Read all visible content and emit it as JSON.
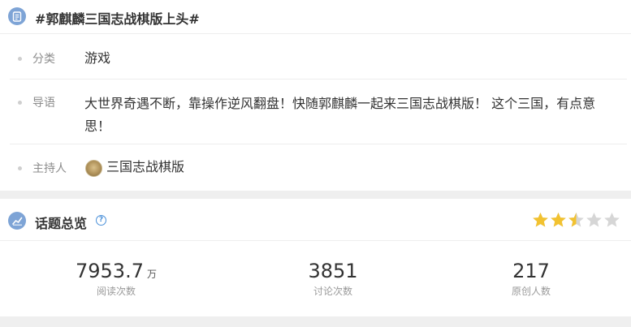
{
  "topic": {
    "title": "#郭麒麟三国志战棋版上头#",
    "icon": "document-icon"
  },
  "details": {
    "category_label": "分类",
    "category_value": "游戏",
    "intro_label": "导语",
    "intro_value": "大世界奇遇不断，靠操作逆风翻盘！快随郭麒麟一起来三国志战棋版！ 这个三国，有点意思！",
    "host_label": "主持人",
    "host_value": "三国志战棋版"
  },
  "overview": {
    "title": "话题总览",
    "help_glyph": "?",
    "rating": 2.5,
    "rating_max": 5,
    "stats": [
      {
        "value": "7953.7",
        "unit": "万",
        "label": "阅读次数"
      },
      {
        "value": "3851",
        "unit": "",
        "label": "讨论次数"
      },
      {
        "value": "217",
        "unit": "",
        "label": "原创人数"
      }
    ]
  },
  "colors": {
    "accent": "#7ea4d6",
    "star_on": "#f2c230",
    "star_off": "#d6d6d6",
    "link": "#4a90d9"
  }
}
